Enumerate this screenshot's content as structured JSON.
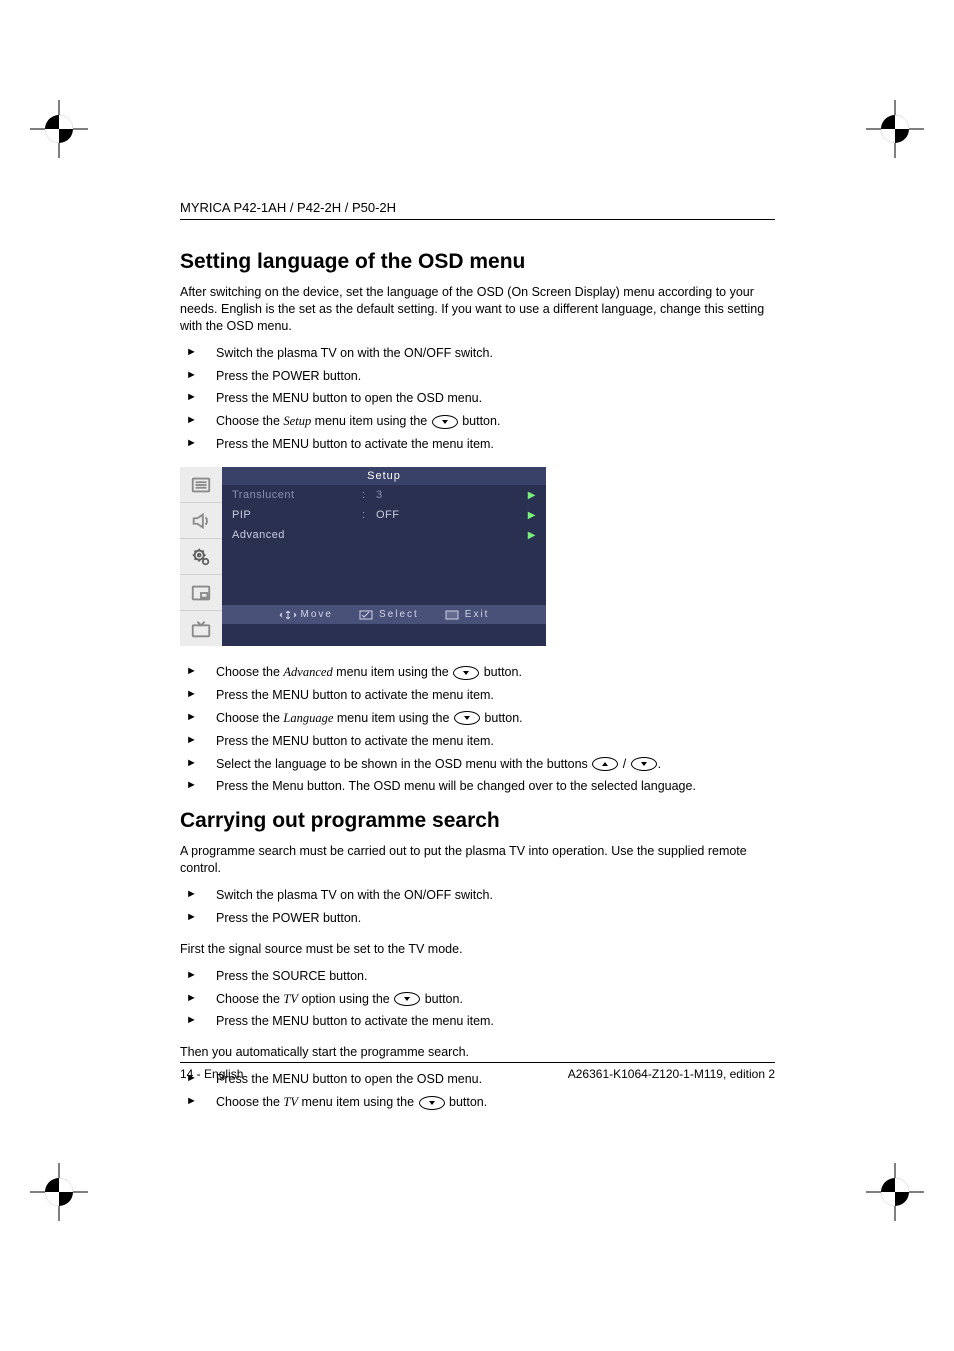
{
  "header": "MYRICA P42-1AH / P42-2H / P50-2H",
  "section1": {
    "title": "Setting language of the OSD menu",
    "intro": "After switching on the device, set the language of the OSD (On Screen Display) menu according to your needs. English is the set as the default setting. If you want to use a different language, change this setting with the OSD menu.",
    "steps_a": [
      "Switch the plasma TV on with the ON/OFF switch.",
      "Press the POWER button.",
      "Press the MENU button to open the OSD menu."
    ],
    "step_setup_pre": "Choose the ",
    "step_setup_it": "Setup",
    "step_setup_mid": " menu item using the ",
    "step_setup_post": " button.",
    "step_a_last": "Press the MENU button to activate the menu item.",
    "steps_b_adv_pre": "Choose the ",
    "steps_b_adv_it": "Advanced",
    "steps_b_adv_mid": " menu item using the ",
    "steps_b_adv_post": " button.",
    "steps_b_1": "Press the MENU button to activate the menu item.",
    "steps_b_lang_pre": "Choose the ",
    "steps_b_lang_it": "Language",
    "steps_b_lang_mid": " menu item using the ",
    "steps_b_lang_post": " button.",
    "steps_b_3": "Press the MENU button to activate the menu item.",
    "steps_b_sel_pre": "Select the language to be shown in the OSD menu with the buttons ",
    "steps_b_sel_mid": " / ",
    "steps_b_sel_post": ".",
    "steps_b_5": "Press the Menu button. The OSD menu will be changed over to the selected language."
  },
  "osd": {
    "title": "Setup",
    "rows": [
      {
        "label": "Translucent",
        "val": "3",
        "muted": true
      },
      {
        "label": "PIP",
        "val": "OFF",
        "muted": false
      },
      {
        "label": "Advanced",
        "val": "",
        "muted": false
      }
    ],
    "footer": {
      "move": "Move",
      "select": "Select",
      "exit": "Exit"
    }
  },
  "section2": {
    "title": "Carrying out programme search",
    "intro": "A programme search must be carried out to put the plasma TV into operation. Use the supplied remote control.",
    "steps_a": [
      "Switch the plasma TV on with the ON/OFF switch.",
      "Press the POWER button."
    ],
    "mid1": "First the signal source must be set to the TV mode.",
    "step_src": "Press the SOURCE button.",
    "step_tv_pre": "Choose the ",
    "step_tv_it": "TV",
    "step_tv_mid": " option using the ",
    "step_tv_post": " button.",
    "step_act": "Press the MENU button to activate the menu item.",
    "mid2": "Then you automatically start the programme search.",
    "step_open": "Press the MENU button to open the OSD menu.",
    "step_tv2_pre": "Choose the ",
    "step_tv2_it": "TV",
    "step_tv2_mid": " menu item using the ",
    "step_tv2_post": " button."
  },
  "footer": {
    "left": "14 - English",
    "right": "A26361-K1064-Z120-1-M119, edition 2"
  }
}
